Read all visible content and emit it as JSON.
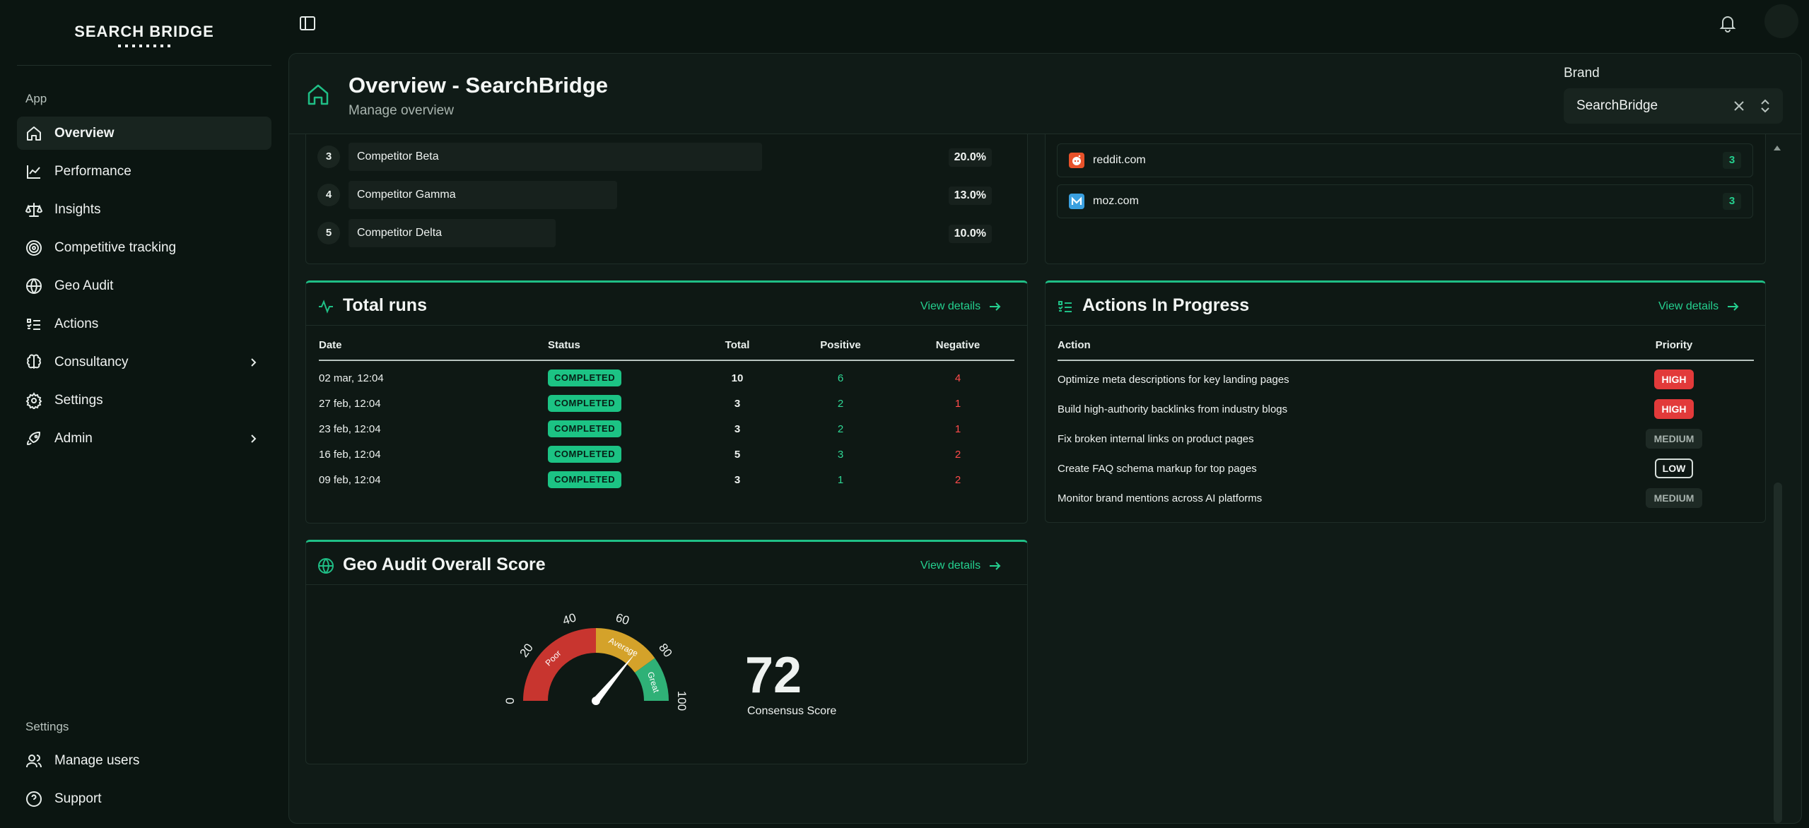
{
  "app": {
    "logo_text": "SEARCH BRIDGE"
  },
  "sidebar": {
    "section_app": "App",
    "section_settings": "Settings",
    "items": [
      {
        "label": "Overview",
        "icon": "home-icon",
        "active": true
      },
      {
        "label": "Performance",
        "icon": "chart-line-icon"
      },
      {
        "label": "Insights",
        "icon": "scale-icon"
      },
      {
        "label": "Competitive tracking",
        "icon": "target-icon"
      },
      {
        "label": "Geo Audit",
        "icon": "globe-icon"
      },
      {
        "label": "Actions",
        "icon": "list-checks-icon"
      },
      {
        "label": "Consultancy",
        "icon": "brain-icon",
        "expandable": true
      },
      {
        "label": "Settings",
        "icon": "gear-icon"
      },
      {
        "label": "Admin",
        "icon": "rocket-icon",
        "expandable": true
      }
    ],
    "bottom_items": [
      {
        "label": "Manage users",
        "icon": "users-icon"
      },
      {
        "label": "Support",
        "icon": "help-circle-icon"
      }
    ]
  },
  "header": {
    "title": "Overview - SearchBridge",
    "subtitle": "Manage overview",
    "brand_label": "Brand",
    "brand_value": "SearchBridge"
  },
  "competitors": [
    {
      "rank": "3",
      "name": "Competitor Beta",
      "share": "20.0%",
      "share_value": 0.2
    },
    {
      "rank": "4",
      "name": "Competitor Gamma",
      "share": "13.0%",
      "share_value": 0.13
    },
    {
      "rank": "5",
      "name": "Competitor Delta",
      "share": "10.0%",
      "share_value": 0.1
    }
  ],
  "domains": [
    {
      "name": "reddit.com",
      "count": "3",
      "icon": "reddit-icon"
    },
    {
      "name": "moz.com",
      "count": "3",
      "icon": "moz-icon"
    }
  ],
  "total_runs": {
    "title": "Total runs",
    "view_details": "View details",
    "columns": [
      "Date",
      "Status",
      "Total",
      "Positive",
      "Negative"
    ],
    "rows": [
      {
        "date": "02 mar, 12:04",
        "status": "COMPLETED",
        "total": "10",
        "positive": "6",
        "negative": "4"
      },
      {
        "date": "27 feb, 12:04",
        "status": "COMPLETED",
        "total": "3",
        "positive": "2",
        "negative": "1"
      },
      {
        "date": "23 feb, 12:04",
        "status": "COMPLETED",
        "total": "3",
        "positive": "2",
        "negative": "1"
      },
      {
        "date": "16 feb, 12:04",
        "status": "COMPLETED",
        "total": "5",
        "positive": "3",
        "negative": "2"
      },
      {
        "date": "09 feb, 12:04",
        "status": "COMPLETED",
        "total": "3",
        "positive": "1",
        "negative": "2"
      }
    ]
  },
  "actions": {
    "title": "Actions In Progress",
    "view_details": "View details",
    "columns": [
      "Action",
      "Priority"
    ],
    "rows": [
      {
        "action": "Optimize meta descriptions for key landing pages",
        "priority": "HIGH"
      },
      {
        "action": "Build high-authority backlinks from industry blogs",
        "priority": "HIGH"
      },
      {
        "action": "Fix broken internal links on product pages",
        "priority": "MEDIUM"
      },
      {
        "action": "Create FAQ schema markup for top pages",
        "priority": "LOW"
      },
      {
        "action": "Monitor brand mentions across AI platforms",
        "priority": "MEDIUM"
      }
    ]
  },
  "geo_audit": {
    "title": "Geo Audit Overall Score",
    "view_details": "View details",
    "score": "72",
    "score_value": 72,
    "score_label": "Consensus Score",
    "ticks": [
      "0",
      "20",
      "40",
      "60",
      "80",
      "100"
    ],
    "bands": [
      {
        "label": "Poor",
        "from": 0,
        "to": 50,
        "color": "#c8352f"
      },
      {
        "label": "Average",
        "from": 50,
        "to": 80,
        "color": "#d4a22a"
      },
      {
        "label": "Great",
        "from": 80,
        "to": 100,
        "color": "#2fb177"
      }
    ]
  },
  "colors": {
    "accent": "#1fbf86",
    "high": "#e23a3a",
    "positive": "#2fd795",
    "negative": "#ff4b4b"
  }
}
